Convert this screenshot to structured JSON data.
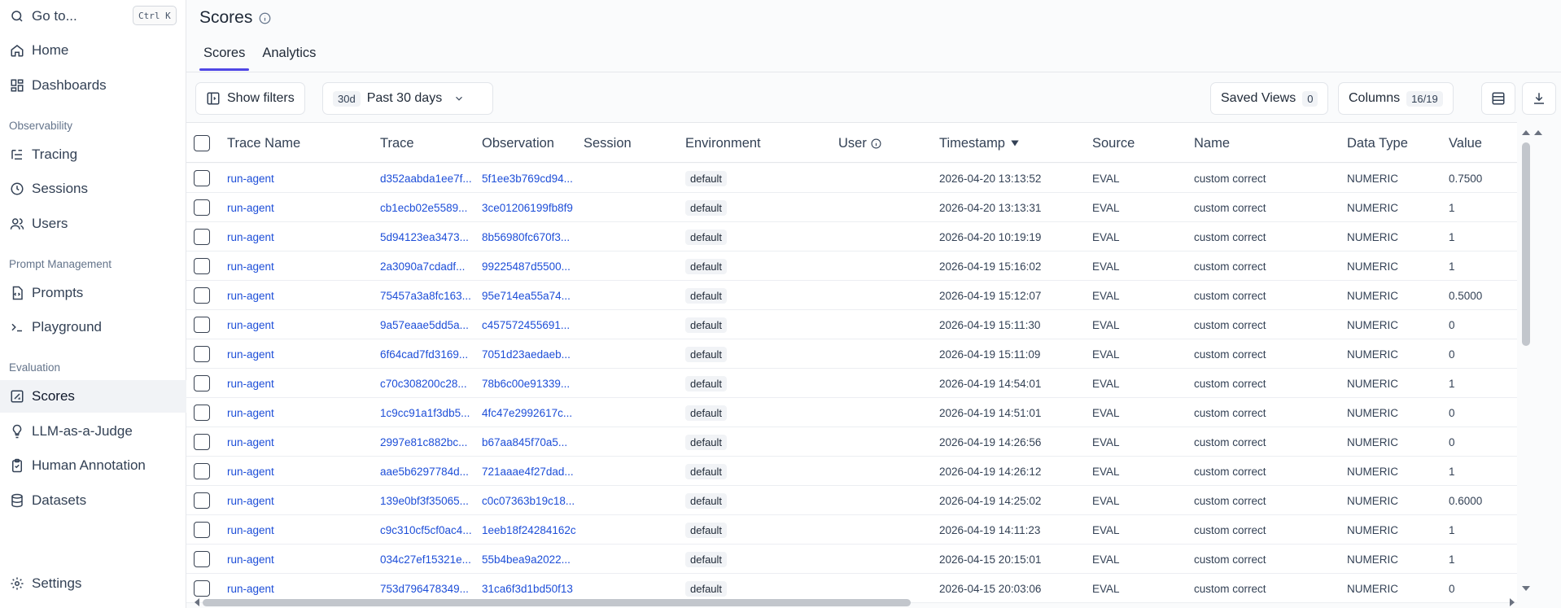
{
  "sidebar": {
    "goto": "Go to...",
    "shortcut": "Ctrl K",
    "home": "Home",
    "dashboards": "Dashboards",
    "section_observability": "Observability",
    "tracing": "Tracing",
    "sessions": "Sessions",
    "users": "Users",
    "section_prompt": "Prompt Management",
    "prompts": "Prompts",
    "playground": "Playground",
    "section_evaluation": "Evaluation",
    "scores": "Scores",
    "llm_judge": "LLM-as-a-Judge",
    "human_annotation": "Human Annotation",
    "datasets": "Datasets",
    "settings": "Settings"
  },
  "header": {
    "title": "Scores",
    "tabs": [
      "Scores",
      "Analytics"
    ]
  },
  "toolbar": {
    "show_filters": "Show filters",
    "range_badge": "30d",
    "range_label": "Past 30 days",
    "saved_views": "Saved Views",
    "saved_views_count": "0",
    "columns": "Columns",
    "columns_count": "16/19"
  },
  "table": {
    "columns": [
      "Trace Name",
      "Trace",
      "Observation",
      "Session",
      "Environment",
      "User",
      "Timestamp",
      "Source",
      "Name",
      "Data Type",
      "Value"
    ],
    "rows": [
      [
        "run-agent",
        "d352aabda1ee7f...",
        "5f1ee3b769cd94...",
        "",
        "default",
        "",
        "2026-04-20 13:13:52",
        "EVAL",
        "custom correct",
        "NUMERIC",
        "0.7500"
      ],
      [
        "run-agent",
        "cb1ecb02e5589...",
        "3ce01206199fb8f9",
        "",
        "default",
        "",
        "2026-04-20 13:13:31",
        "EVAL",
        "custom correct",
        "NUMERIC",
        "1"
      ],
      [
        "run-agent",
        "5d94123ea3473...",
        "8b56980fc670f3...",
        "",
        "default",
        "",
        "2026-04-20 10:19:19",
        "EVAL",
        "custom correct",
        "NUMERIC",
        "1"
      ],
      [
        "run-agent",
        "2a3090a7cdadf...",
        "99225487d5500...",
        "",
        "default",
        "",
        "2026-04-19 15:16:02",
        "EVAL",
        "custom correct",
        "NUMERIC",
        "1"
      ],
      [
        "run-agent",
        "75457a3a8fc163...",
        "95e714ea55a74...",
        "",
        "default",
        "",
        "2026-04-19 15:12:07",
        "EVAL",
        "custom correct",
        "NUMERIC",
        "0.5000"
      ],
      [
        "run-agent",
        "9a57eaae5dd5a...",
        "c457572455691...",
        "",
        "default",
        "",
        "2026-04-19 15:11:30",
        "EVAL",
        "custom correct",
        "NUMERIC",
        "0"
      ],
      [
        "run-agent",
        "6f64cad7fd3169...",
        "7051d23aedaeb...",
        "",
        "default",
        "",
        "2026-04-19 15:11:09",
        "EVAL",
        "custom correct",
        "NUMERIC",
        "0"
      ],
      [
        "run-agent",
        "c70c308200c28...",
        "78b6c00e91339...",
        "",
        "default",
        "",
        "2026-04-19 14:54:01",
        "EVAL",
        "custom correct",
        "NUMERIC",
        "1"
      ],
      [
        "run-agent",
        "1c9cc91a1f3db5...",
        "4fc47e2992617c...",
        "",
        "default",
        "",
        "2026-04-19 14:51:01",
        "EVAL",
        "custom correct",
        "NUMERIC",
        "0"
      ],
      [
        "run-agent",
        "2997e81c882bc...",
        "b67aa845f70a5...",
        "",
        "default",
        "",
        "2026-04-19 14:26:56",
        "EVAL",
        "custom correct",
        "NUMERIC",
        "0"
      ],
      [
        "run-agent",
        "aae5b6297784d...",
        "721aaae4f27dad...",
        "",
        "default",
        "",
        "2026-04-19 14:26:12",
        "EVAL",
        "custom correct",
        "NUMERIC",
        "1"
      ],
      [
        "run-agent",
        "139e0bf3f35065...",
        "c0c07363b19c18...",
        "",
        "default",
        "",
        "2026-04-19 14:25:02",
        "EVAL",
        "custom correct",
        "NUMERIC",
        "0.6000"
      ],
      [
        "run-agent",
        "c9c310cf5cf0ac4...",
        "1eeb18f24284162c",
        "",
        "default",
        "",
        "2026-04-19 14:11:23",
        "EVAL",
        "custom correct",
        "NUMERIC",
        "1"
      ],
      [
        "run-agent",
        "034c27ef15321e...",
        "55b4bea9a2022...",
        "",
        "default",
        "",
        "2026-04-15 20:15:01",
        "EVAL",
        "custom correct",
        "NUMERIC",
        "1"
      ],
      [
        "run-agent",
        "753d796478349...",
        "31ca6f3d1bd50f13",
        "",
        "default",
        "",
        "2026-04-15 20:03:06",
        "EVAL",
        "custom correct",
        "NUMERIC",
        "0"
      ]
    ]
  }
}
